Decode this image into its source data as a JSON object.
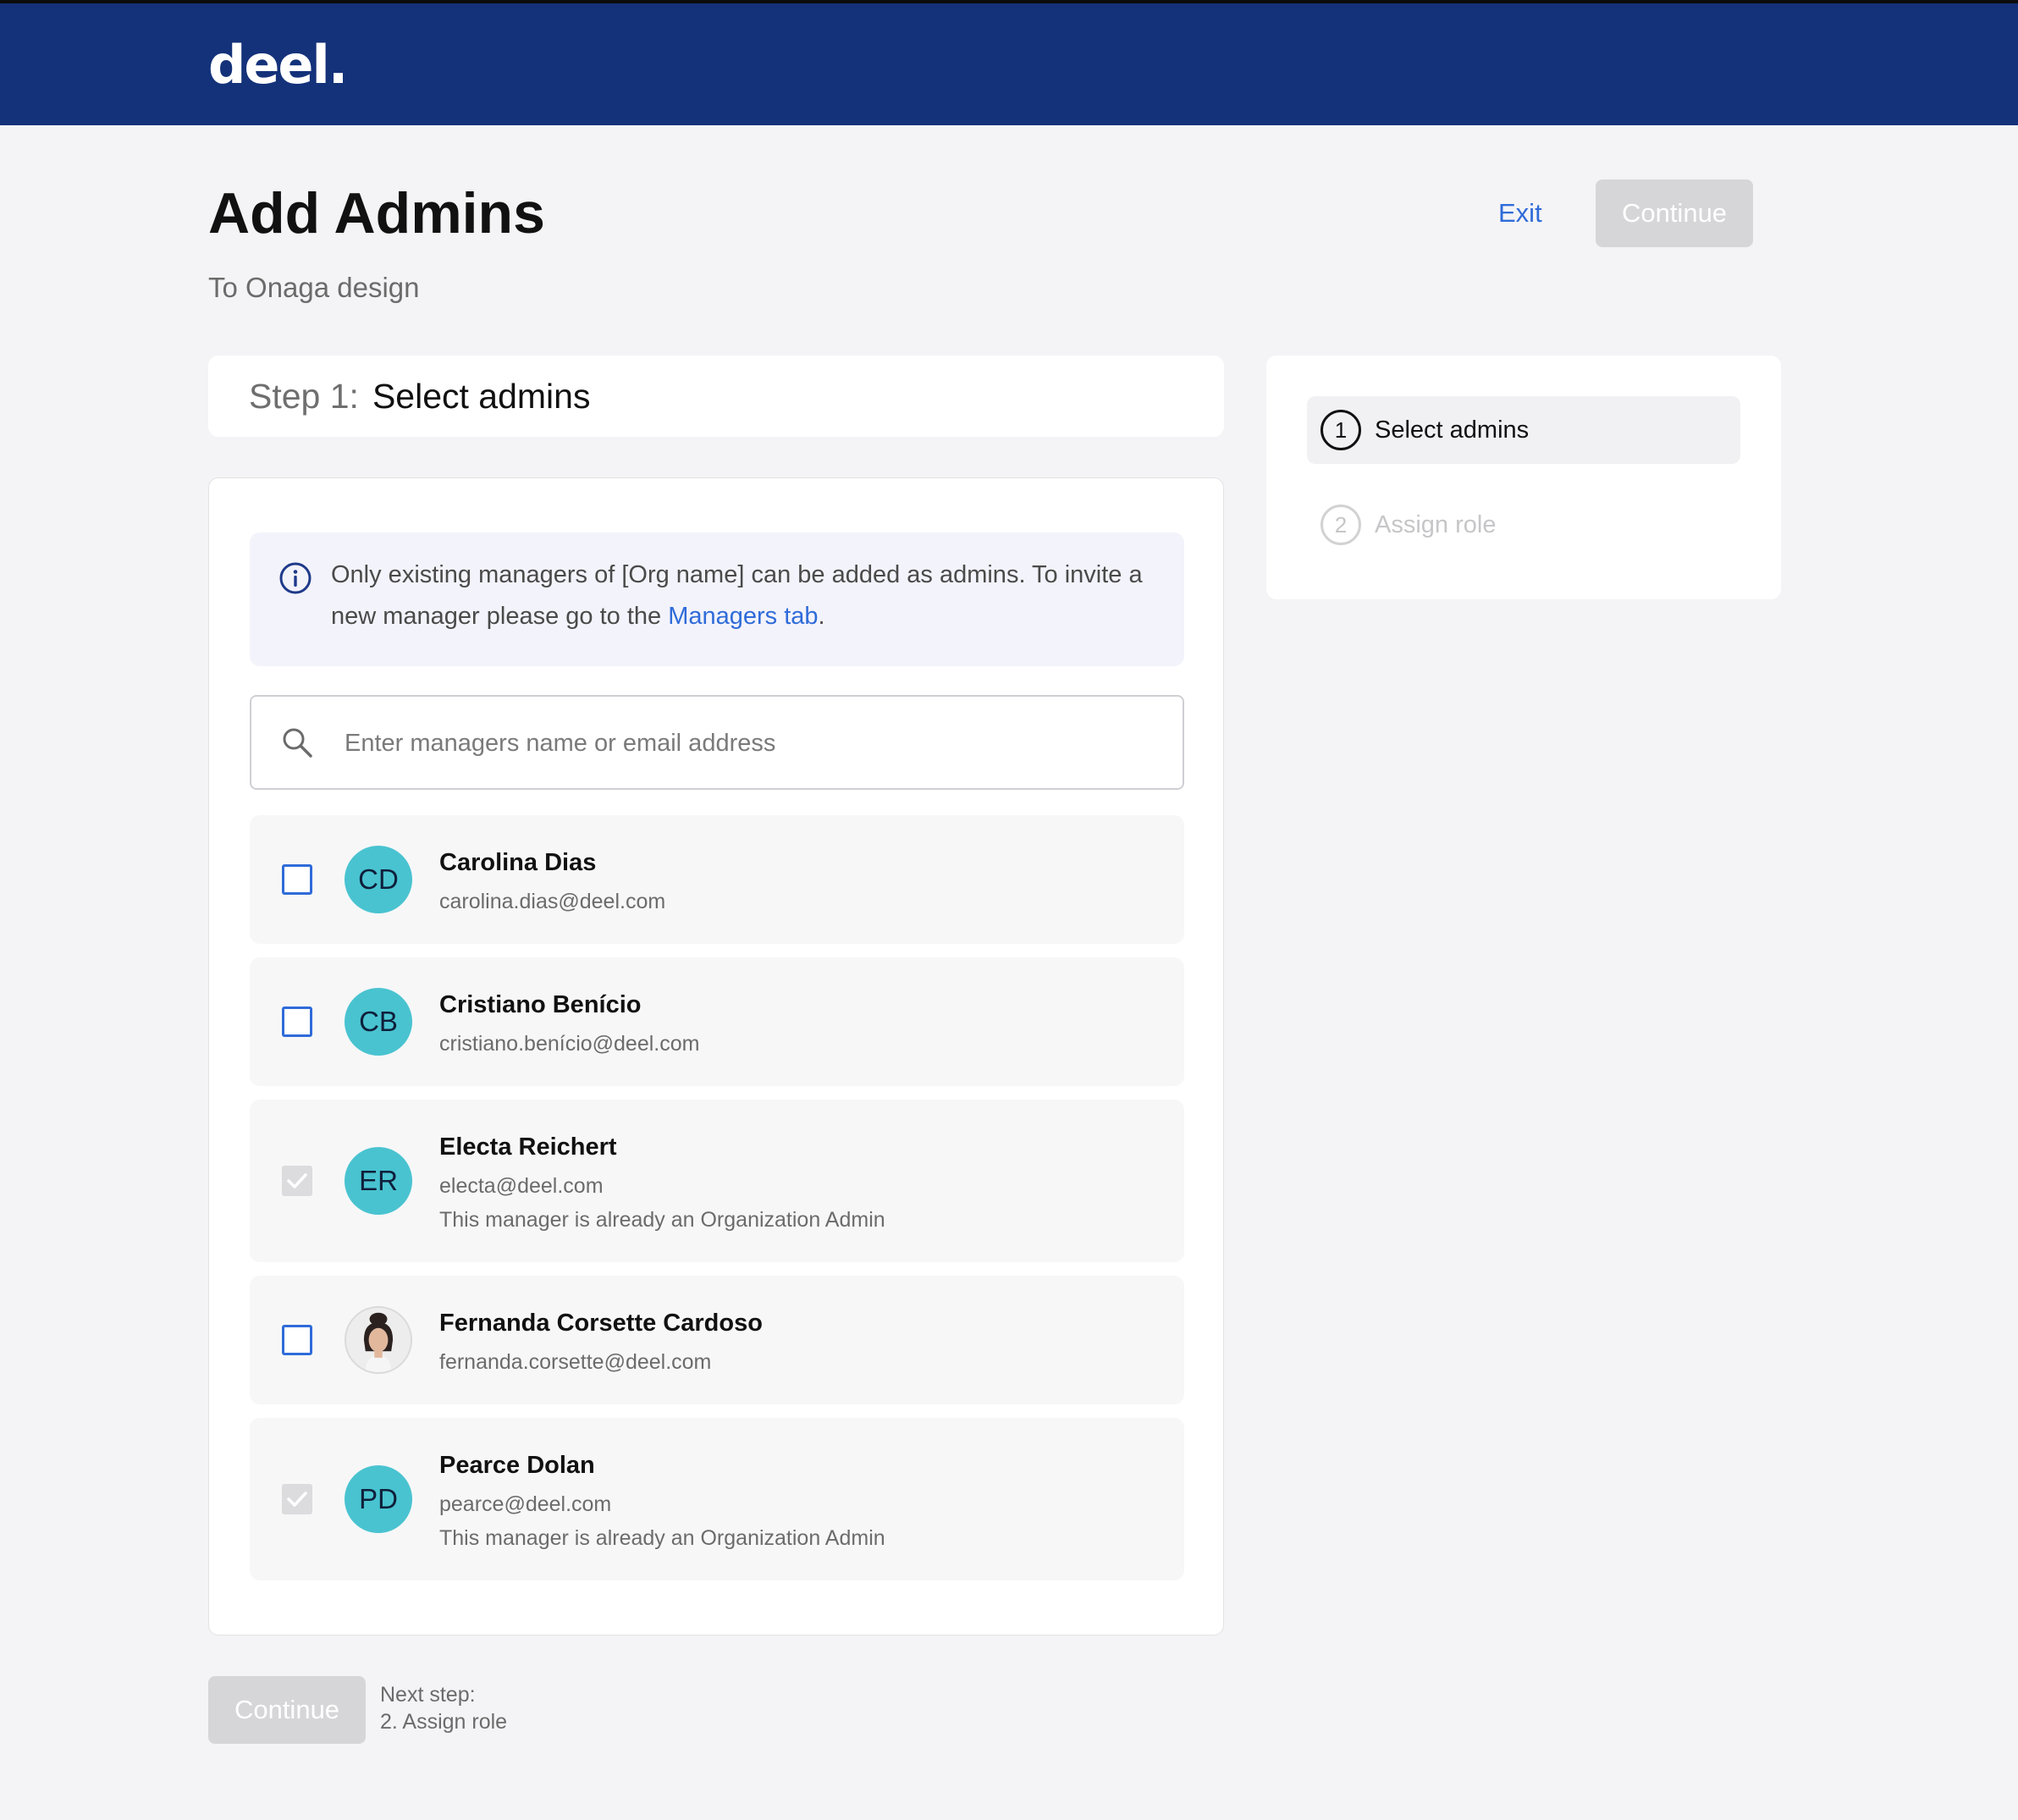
{
  "header": {
    "logo": "deel."
  },
  "page": {
    "title": "Add Admins",
    "subtitle": "To Onaga design",
    "exit_label": "Exit",
    "continue_label": "Continue"
  },
  "step_header": {
    "prefix": "Step 1:",
    "title": "Select admins"
  },
  "info": {
    "text": "Only existing managers of [Org name] can be added as admins. To invite a new manager please go to the ",
    "link": "Managers tab",
    "suffix": "."
  },
  "search": {
    "placeholder": "Enter managers name or email address",
    "value": ""
  },
  "managers": [
    {
      "initials": "CD",
      "name": "Carolina Dias",
      "email": "carolina.dias@deel.com",
      "note": "",
      "checked": false,
      "disabled": false,
      "avatar": "initials"
    },
    {
      "initials": "CB",
      "name": "Cristiano Benício",
      "email": "cristiano.benício@deel.com",
      "note": "",
      "checked": false,
      "disabled": false,
      "avatar": "initials"
    },
    {
      "initials": "ER",
      "name": "Electa Reichert",
      "email": "electa@deel.com",
      "note": "This manager is already an Organization Admin",
      "checked": true,
      "disabled": true,
      "avatar": "initials"
    },
    {
      "initials": "",
      "name": "Fernanda Corsette Cardoso",
      "email": "fernanda.corsette@deel.com",
      "note": "",
      "checked": false,
      "disabled": false,
      "avatar": "photo"
    },
    {
      "initials": "PD",
      "name": "Pearce Dolan",
      "email": "pearce@deel.com",
      "note": "This manager is already an Organization Admin",
      "checked": true,
      "disabled": true,
      "avatar": "initials"
    }
  ],
  "footer": {
    "continue_label": "Continue",
    "next_step_label": "Next step:",
    "next_step_value": "2. Assign role"
  },
  "steps": [
    {
      "number": "1",
      "label": "Select admins",
      "state": "active"
    },
    {
      "number": "2",
      "label": "Assign role",
      "state": "inactive"
    }
  ],
  "colors": {
    "header_bg": "#14327a",
    "accent": "#2f6bd9",
    "avatar_bg": "#49c3d0",
    "disabled_button": "#d6d6d8"
  }
}
